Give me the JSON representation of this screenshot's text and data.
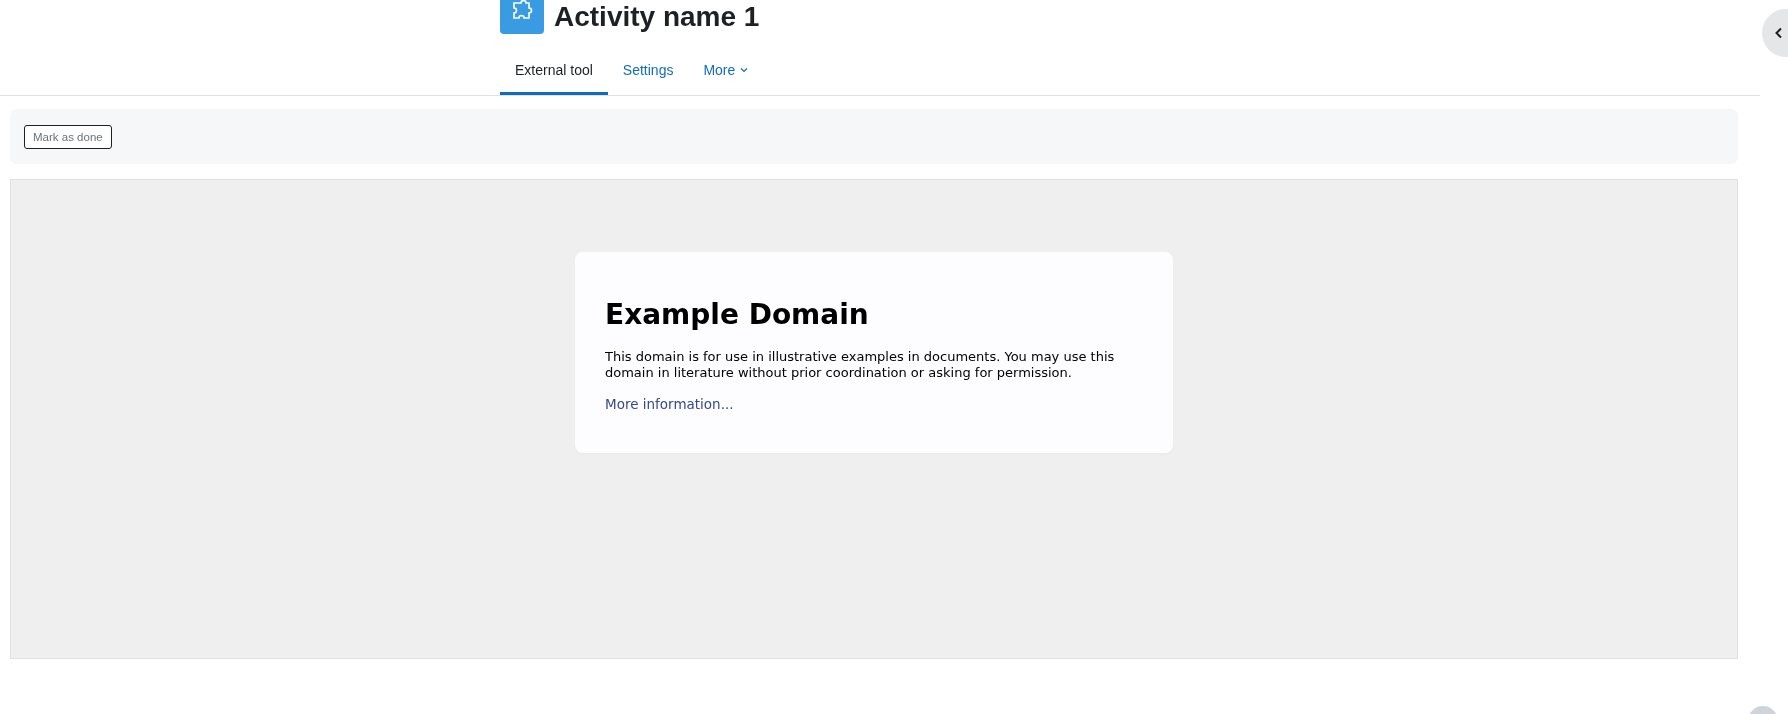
{
  "header": {
    "title": "Activity name 1"
  },
  "tabs": [
    {
      "label": "External tool",
      "selected": true,
      "has_menu": false
    },
    {
      "label": "Settings",
      "selected": false,
      "has_menu": false
    },
    {
      "label": "More",
      "selected": false,
      "has_menu": true
    }
  ],
  "completion": {
    "button": "Mark as done"
  },
  "embedded_page": {
    "heading": "Example Domain",
    "paragraph": "This domain is for use in illustrative examples in documents. You may use this domain in literature without prior coordination or asking for permission.",
    "link": "More information..."
  }
}
